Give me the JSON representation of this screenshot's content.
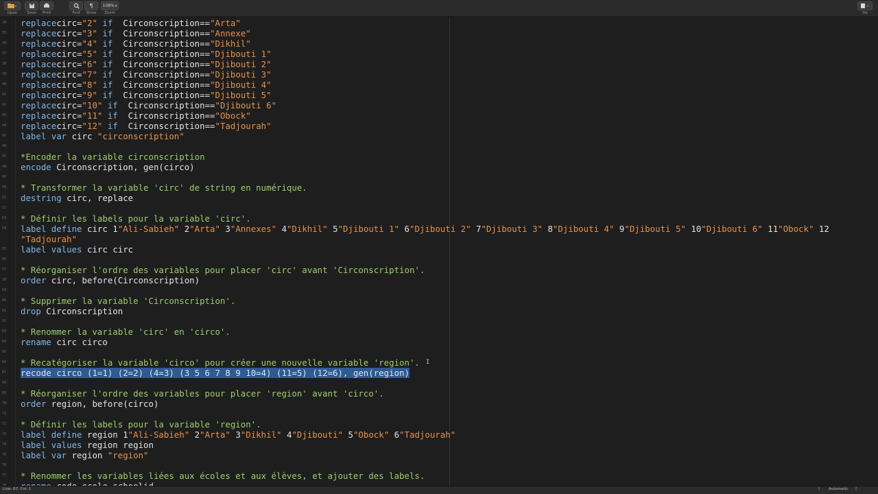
{
  "toolbar": {
    "open_label": "Open",
    "save_label": "Save",
    "print_label": "Print",
    "find_label": "Find",
    "show_label": "Show",
    "zoom_label": "Zoom",
    "zoom_value": "108%",
    "do_label": "Do"
  },
  "editor": {
    "lines": [
      {
        "n": "34",
        "tokens": [
          [
            "kw",
            "replace"
          ],
          [
            "",
            "circ="
          ],
          [
            "str",
            "\"2\""
          ],
          [
            "",
            ""
          ],
          [
            "kw",
            " if"
          ],
          [
            "",
            ""
          ],
          [
            "",
            "  Circonscription=="
          ],
          [
            "str",
            "\"Arta\""
          ]
        ]
      },
      {
        "n": "35",
        "tokens": [
          [
            "kw",
            "replace"
          ],
          [
            "",
            "circ="
          ],
          [
            "str",
            "\"3\""
          ],
          [
            "kw",
            " if"
          ],
          [
            "",
            "  Circonscription=="
          ],
          [
            "str",
            "\"Annexe\""
          ]
        ]
      },
      {
        "n": "36",
        "tokens": [
          [
            "kw",
            "replace"
          ],
          [
            "",
            "circ="
          ],
          [
            "str",
            "\"4\""
          ],
          [
            "kw",
            " if"
          ],
          [
            "",
            "  Circonscription=="
          ],
          [
            "str",
            "\"Dikhil\""
          ]
        ]
      },
      {
        "n": "37",
        "tokens": [
          [
            "kw",
            "replace"
          ],
          [
            "",
            "circ="
          ],
          [
            "str",
            "\"5\""
          ],
          [
            "kw",
            " if"
          ],
          [
            "",
            "  Circonscription=="
          ],
          [
            "str",
            "\"Djibouti 1\""
          ]
        ]
      },
      {
        "n": "38",
        "tokens": [
          [
            "kw",
            "replace"
          ],
          [
            "",
            "circ="
          ],
          [
            "str",
            "\"6\""
          ],
          [
            "kw",
            " if"
          ],
          [
            "",
            "  Circonscription=="
          ],
          [
            "str",
            "\"Djibouti 2\""
          ]
        ]
      },
      {
        "n": "39",
        "tokens": [
          [
            "kw",
            "replace"
          ],
          [
            "",
            "circ="
          ],
          [
            "str",
            "\"7\""
          ],
          [
            "kw",
            " if"
          ],
          [
            "",
            "  Circonscription=="
          ],
          [
            "str",
            "\"Djibouti 3\""
          ]
        ]
      },
      {
        "n": "40",
        "tokens": [
          [
            "kw",
            "replace"
          ],
          [
            "",
            "circ="
          ],
          [
            "str",
            "\"8\""
          ],
          [
            "kw",
            " if"
          ],
          [
            "",
            "  Circonscription=="
          ],
          [
            "str",
            "\"Djibouti 4\""
          ]
        ]
      },
      {
        "n": "41",
        "tokens": [
          [
            "kw",
            "replace"
          ],
          [
            "",
            "circ="
          ],
          [
            "str",
            "\"9\""
          ],
          [
            "kw",
            " if"
          ],
          [
            "",
            "  Circonscription=="
          ],
          [
            "str",
            "\"Djibouti 5\""
          ]
        ]
      },
      {
        "n": "42",
        "tokens": [
          [
            "kw",
            "replace"
          ],
          [
            "",
            "circ="
          ],
          [
            "str",
            "\"10\""
          ],
          [
            "kw",
            " if"
          ],
          [
            "",
            "  Circonscription=="
          ],
          [
            "str",
            "\"Djibouti 6\""
          ]
        ]
      },
      {
        "n": "43",
        "tokens": [
          [
            "kw",
            "replace"
          ],
          [
            "",
            "circ="
          ],
          [
            "str",
            "\"11\""
          ],
          [
            "kw",
            " if"
          ],
          [
            "",
            "  Circonscription=="
          ],
          [
            "str",
            "\"Obock\""
          ]
        ]
      },
      {
        "n": "44",
        "tokens": [
          [
            "kw",
            "replace"
          ],
          [
            "",
            "circ="
          ],
          [
            "str",
            "\"12\""
          ],
          [
            "kw",
            " if"
          ],
          [
            "",
            "  Circonscription=="
          ],
          [
            "str",
            "\"Tadjourah\""
          ]
        ]
      },
      {
        "n": "45",
        "tokens": [
          [
            "kw",
            "label var"
          ],
          [
            "",
            " circ "
          ],
          [
            "str",
            "\"circonscription\""
          ]
        ]
      },
      {
        "n": "46",
        "tokens": []
      },
      {
        "n": "47",
        "tokens": [
          [
            "cm",
            "*Encoder la variable circonscription"
          ]
        ]
      },
      {
        "n": "48",
        "tokens": [
          [
            "kw",
            "encode"
          ],
          [
            "",
            " Circonscription, gen(circo)"
          ]
        ]
      },
      {
        "n": "49",
        "tokens": []
      },
      {
        "n": "50",
        "tokens": [
          [
            "cm",
            "* Transformer la variable 'circ' de string en numérique."
          ]
        ]
      },
      {
        "n": "51",
        "tokens": [
          [
            "kw",
            "destring"
          ],
          [
            "",
            " circ, replace"
          ]
        ]
      },
      {
        "n": "52",
        "tokens": []
      },
      {
        "n": "53",
        "tokens": [
          [
            "cm",
            "* Définir les labels pour la variable 'circ'."
          ]
        ]
      },
      {
        "n": "54",
        "tokens": [
          [
            "kw",
            "label define"
          ],
          [
            "",
            " circ 1"
          ],
          [
            "str",
            "\"Ali-Sabieh\""
          ],
          [
            "",
            " 2"
          ],
          [
            "str",
            "\"Arta\""
          ],
          [
            "",
            " 3"
          ],
          [
            "str",
            "\"Annexes\""
          ],
          [
            "",
            " 4"
          ],
          [
            "str",
            "\"Dikhil\""
          ],
          [
            "",
            " 5"
          ],
          [
            "str",
            "\"Djibouti 1\""
          ],
          [
            "",
            " 6"
          ],
          [
            "str",
            "\"Djibouti 2\""
          ],
          [
            "",
            " 7"
          ],
          [
            "str",
            "\"Djibouti 3\""
          ],
          [
            "",
            " 8"
          ],
          [
            "str",
            "\"Djibouti 4\""
          ],
          [
            "",
            " 9"
          ],
          [
            "str",
            "\"Djibouti 5\""
          ],
          [
            "",
            " 10"
          ],
          [
            "str",
            "\"Djibouti 6\""
          ],
          [
            "",
            " 11"
          ],
          [
            "str",
            "\"Obock\""
          ],
          [
            "",
            " 12"
          ]
        ]
      },
      {
        "n": "",
        "tokens": [
          [
            "str",
            "\"Tadjourah\""
          ]
        ]
      },
      {
        "n": "55",
        "tokens": [
          [
            "kw",
            "label values"
          ],
          [
            "",
            " circ circ"
          ]
        ]
      },
      {
        "n": "56",
        "tokens": []
      },
      {
        "n": "57",
        "tokens": [
          [
            "cm",
            "* Réorganiser l'ordre des variables pour placer 'circ' avant 'Circonscription'."
          ]
        ]
      },
      {
        "n": "58",
        "tokens": [
          [
            "kw",
            "order"
          ],
          [
            "",
            " circ, before(Circonscription)"
          ]
        ]
      },
      {
        "n": "59",
        "tokens": []
      },
      {
        "n": "60",
        "tokens": [
          [
            "cm",
            "* Supprimer la variable 'Circonscription'."
          ]
        ]
      },
      {
        "n": "61",
        "tokens": [
          [
            "kw",
            "drop"
          ],
          [
            "",
            " Circonscription"
          ]
        ]
      },
      {
        "n": "62",
        "tokens": []
      },
      {
        "n": "63",
        "tokens": [
          [
            "cm",
            "* Renommer la variable 'circ' en 'circo'."
          ]
        ]
      },
      {
        "n": "64",
        "tokens": [
          [
            "kw",
            "rename"
          ],
          [
            "",
            " circ circo"
          ]
        ]
      },
      {
        "n": "65",
        "tokens": []
      },
      {
        "n": "66",
        "tokens": [
          [
            "cm",
            "* Recatégoriser la variable 'circo' pour créer une nouvelle variable 'region'."
          ]
        ]
      },
      {
        "n": "67",
        "tokens": [
          [
            "sel",
            "recode circo (1=1) (2=2) (4=3) (3 5 6 7 8 9 10=4) (11=5) (12=6), gen(region)"
          ]
        ]
      },
      {
        "n": "68",
        "tokens": []
      },
      {
        "n": "69",
        "tokens": [
          [
            "cm",
            "* Réorganiser l'ordre des variables pour placer 'region' avant 'circo'."
          ]
        ]
      },
      {
        "n": "70",
        "tokens": [
          [
            "kw",
            "order"
          ],
          [
            "",
            " region, before(circo)"
          ]
        ]
      },
      {
        "n": "71",
        "tokens": []
      },
      {
        "n": "72",
        "tokens": [
          [
            "cm",
            "* Définir les labels pour la variable 'region'."
          ]
        ]
      },
      {
        "n": "73",
        "tokens": [
          [
            "kw",
            "label define"
          ],
          [
            "",
            " region 1"
          ],
          [
            "str",
            "\"Ali-Sabieh\""
          ],
          [
            "",
            " 2"
          ],
          [
            "str",
            "\"Arta\""
          ],
          [
            "",
            " 3"
          ],
          [
            "str",
            "\"Dikhil\""
          ],
          [
            "",
            " 4"
          ],
          [
            "str",
            "\"Djibouti\""
          ],
          [
            "",
            " 5"
          ],
          [
            "str",
            "\"Obock\""
          ],
          [
            "",
            " 6"
          ],
          [
            "str",
            "\"Tadjourah\""
          ]
        ]
      },
      {
        "n": "74",
        "tokens": [
          [
            "kw",
            "label values"
          ],
          [
            "",
            " region region"
          ]
        ]
      },
      {
        "n": "75",
        "tokens": [
          [
            "kw",
            "label var"
          ],
          [
            "",
            " region "
          ],
          [
            "str",
            "\"region\""
          ]
        ]
      },
      {
        "n": "76",
        "tokens": []
      },
      {
        "n": "77",
        "tokens": [
          [
            "cm",
            "* Renommer les variables liées aux écoles et aux élèves, et ajouter des labels."
          ]
        ]
      },
      {
        "n": "78",
        "tokens": [
          [
            "kw",
            "rename"
          ],
          [
            "",
            " code_ecole schoolid"
          ]
        ]
      }
    ]
  },
  "statusbar": {
    "position": "Line: 67, Col: 1",
    "mode": "Automatic"
  }
}
